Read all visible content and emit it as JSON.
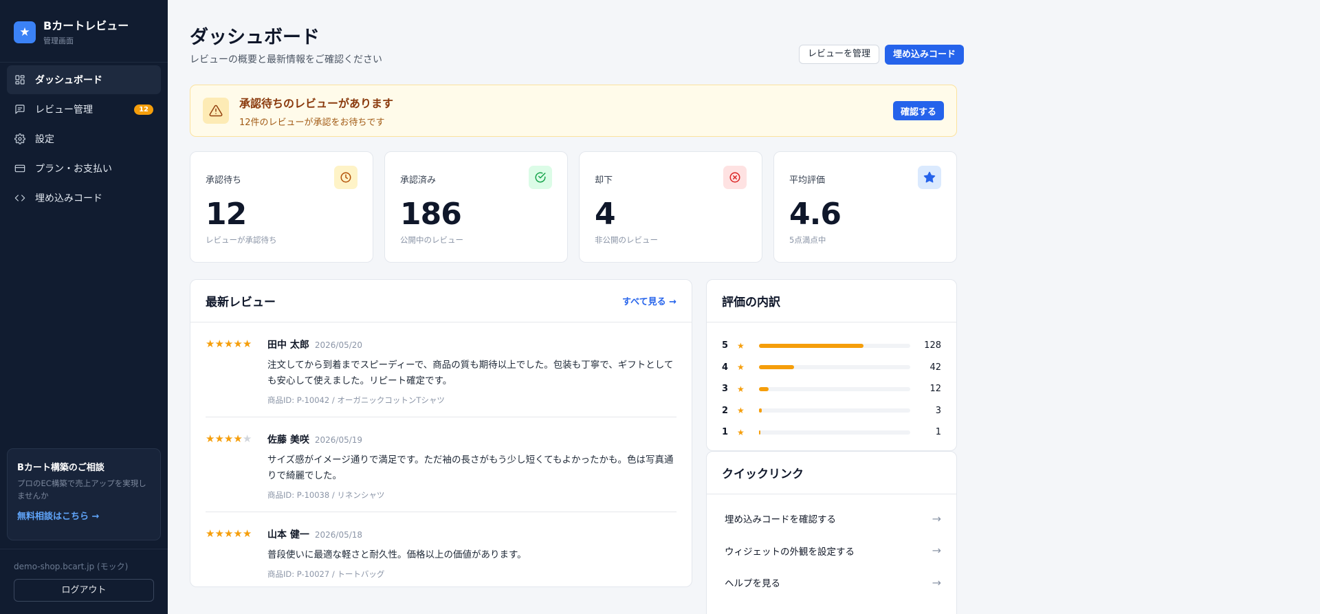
{
  "brand": {
    "title": "Bカートレビュー",
    "subtitle": "管理画面"
  },
  "sidebar": {
    "items": [
      {
        "label": "ダッシュボード",
        "icon": "dashboard-icon",
        "active": true
      },
      {
        "label": "レビュー管理",
        "icon": "message-icon",
        "badge": "12"
      },
      {
        "label": "設定",
        "icon": "gear-icon"
      },
      {
        "label": "プラン・お支払い",
        "icon": "credit-card-icon"
      },
      {
        "label": "埋め込みコード",
        "icon": "code-icon"
      }
    ],
    "promo": {
      "title": "Bカート構築のご相談",
      "text": "プロのEC構築で売上アップを実現しませんか",
      "link": "無料相談はこちら →"
    },
    "shop_domain": "demo-shop.bcart.jp (モック)",
    "logout": "ログアウト"
  },
  "header": {
    "title": "ダッシュボード",
    "subtitle": "レビューの概要と最新情報をご確認ください",
    "manage_button": "レビューを管理",
    "embed_button": "埋め込みコード"
  },
  "alert": {
    "title": "承認待ちのレビューがあります",
    "description": "12件のレビューが承認をお待ちです",
    "button": "確認する"
  },
  "stats": [
    {
      "label": "承認待ち",
      "value": "12",
      "sub": "レビューが承認待ち",
      "icon": "clock-icon",
      "color": "#d97706",
      "bg": "#fef3c7"
    },
    {
      "label": "承認済み",
      "value": "186",
      "sub": "公開中のレビュー",
      "icon": "check-circle-icon",
      "color": "#16a34a",
      "bg": "#dcfce7"
    },
    {
      "label": "却下",
      "value": "4",
      "sub": "非公開のレビュー",
      "icon": "x-circle-icon",
      "color": "#dc2626",
      "bg": "#fee2e2"
    },
    {
      "label": "平均評価",
      "value": "4.6",
      "sub": "5点満点中",
      "icon": "star-icon",
      "color": "#2563eb",
      "bg": "#dbeafe"
    }
  ],
  "reviews": {
    "title": "最新レビュー",
    "see_all": "すべて見る →",
    "items": [
      {
        "rating": 5,
        "name": "田中 太郎",
        "date": "2026/05/20",
        "text": "注文してから到着までスピーディーで、商品の質も期待以上でした。包装も丁寧で、ギフトとしても安心して使えました。リピート確定です。",
        "meta": "商品ID: P-10042 / オーガニックコットンTシャツ"
      },
      {
        "rating": 4,
        "name": "佐藤 美咲",
        "date": "2026/05/19",
        "text": "サイズ感がイメージ通りで満足です。ただ袖の長さがもう少し短くてもよかったかも。色は写真通りで綺麗でした。",
        "meta": "商品ID: P-10038 / リネンシャツ"
      },
      {
        "rating": 5,
        "name": "山本 健一",
        "date": "2026/05/18",
        "text": "普段使いに最適な軽さと耐久性。価格以上の価値があります。",
        "meta": "商品ID: P-10027 / トートバッグ"
      }
    ]
  },
  "breakdown": {
    "title": "評価の内訳",
    "rows": [
      {
        "stars": "5",
        "count": "128",
        "fraction": 0.69
      },
      {
        "stars": "4",
        "count": "42",
        "fraction": 0.23
      },
      {
        "stars": "3",
        "count": "12",
        "fraction": 0.065
      },
      {
        "stars": "2",
        "count": "3",
        "fraction": 0.016
      },
      {
        "stars": "1",
        "count": "1",
        "fraction": 0.006
      }
    ]
  },
  "quick_links": {
    "title": "クイックリンク",
    "items": [
      {
        "label": "埋め込みコードを確認する"
      },
      {
        "label": "ウィジェットの外観を設定する"
      },
      {
        "label": "ヘルプを見る"
      }
    ]
  }
}
